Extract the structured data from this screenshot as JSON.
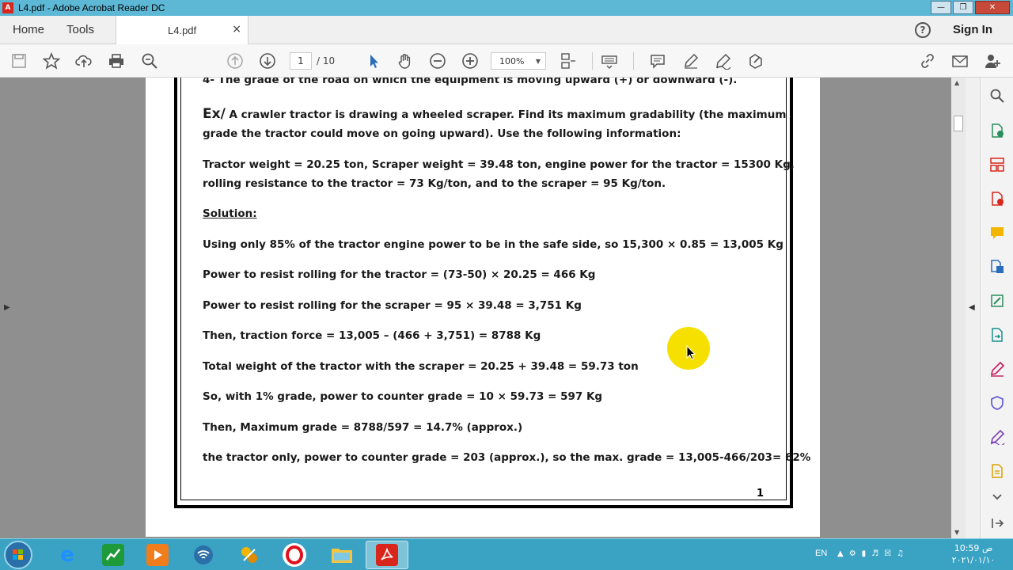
{
  "window": {
    "title": "L4.pdf - Adobe Acrobat Reader DC"
  },
  "tabs": {
    "home": "Home",
    "tools": "Tools",
    "document": "L4.pdf",
    "close": "×",
    "help": "?",
    "signin": "Sign In"
  },
  "toolbar": {
    "page_current": "1",
    "page_total": "/ 10",
    "zoom": "100%"
  },
  "document": {
    "lines": [
      "4- The grade of the road on which the equipment is moving upward (+) or downward (-).",
      "Ex/",
      "A crawler tractor is drawing a wheeled scraper. Find its maximum gradability (the maximum",
      "grade the tractor could move on going upward). Use the following information:",
      "Tractor weight = 20.25 ton, Scraper weight = 39.48 ton, engine power for the tractor = 15300 Kg,",
      "rolling resistance to the tractor = 73 Kg/ton, and to the scraper = 95 Kg/ton.",
      "Solution:",
      "Using only 85% of the tractor engine power to be in the safe side, so 15,300 × 0.85 = 13,005 Kg",
      "Power to resist rolling for the tractor = (73-50) × 20.25 = 466 Kg",
      "Power to resist rolling for the scraper = 95 × 39.48 = 3,751 Kg",
      "Then, traction force = 13,005 – (466 + 3,751) = 8788 Kg",
      "Total weight of the tractor with the scraper = 20.25 + 39.48 = 59.73 ton",
      "So, with 1% grade, power to counter grade = 10 × 59.73 = 597 Kg",
      "Then, Maximum grade = 8788/597 = 14.7% (approx.)",
      "the tractor only, power to counter grade = 203 (approx.), so the max. grade = 13,005-466/203= 62%"
    ],
    "page_number": "1"
  },
  "taskbar": {
    "language": "EN",
    "time": "10:59 ص",
    "date": "٢٠٢١/٠١/١٠"
  },
  "colors": {
    "titlebar": "#5db8d6",
    "taskbar": "#3aa3c4",
    "highlight": "#f5e000",
    "acrobat_red": "#d9261c"
  }
}
